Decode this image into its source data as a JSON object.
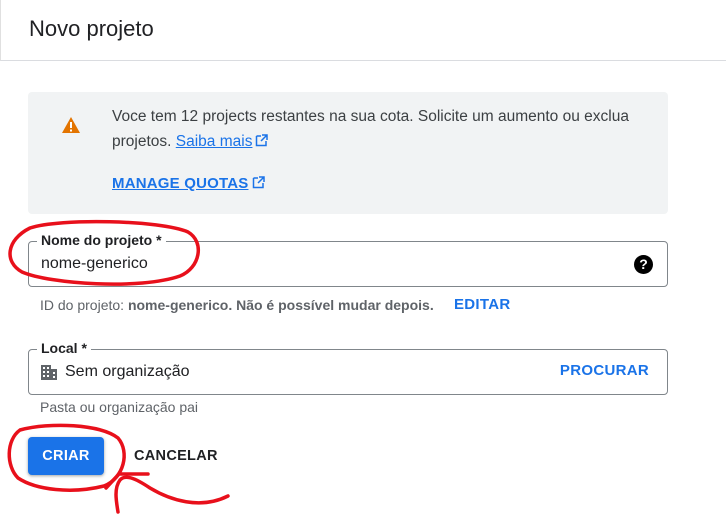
{
  "header": {
    "title": "Novo projeto"
  },
  "quota_banner": {
    "message": "Voce tem 12 projects restantes na sua cota. Solicite um aumento ou exclua projetos.",
    "learn_more": "Saiba mais",
    "manage_quotas": "MANAGE QUOTAS",
    "icon": "warning-icon",
    "icon_color": "#e37400"
  },
  "project_name": {
    "label": "Nome do projeto *",
    "value": "nome-generico",
    "help_icon": "help-icon"
  },
  "project_id": {
    "prefix": "ID do projeto:",
    "value": "nome-generico",
    "suffix": ". Não é possível mudar depois.",
    "edit": "EDITAR"
  },
  "location": {
    "label": "Local *",
    "value": "Sem organização",
    "search": "PROCURAR",
    "hint": "Pasta ou organização pai",
    "icon": "building-icon"
  },
  "actions": {
    "create": "CRIAR",
    "cancel": "CANCELAR"
  },
  "colors": {
    "primary": "#1a73e8",
    "annotation": "#e8101b"
  }
}
